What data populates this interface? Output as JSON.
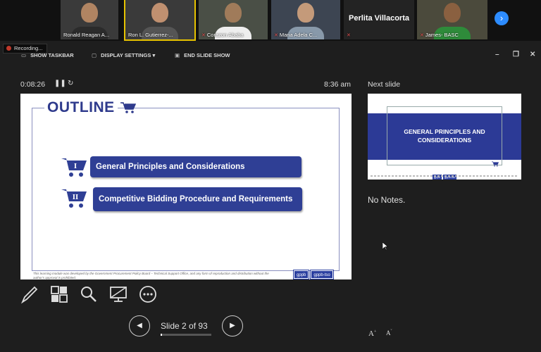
{
  "participants": [
    {
      "name": "Ronald Reagan A...",
      "muted": false
    },
    {
      "name": "Ron L. Gutierrez-...",
      "muted": false,
      "active": true
    },
    {
      "name": "Corazon Ababa",
      "muted": true
    },
    {
      "name": "Maria Adela C...",
      "muted": true
    },
    {
      "name": "Perlita Villacorta",
      "muted": true,
      "video": false
    },
    {
      "name": "James- BASC",
      "muted": true
    }
  ],
  "participants_next_icon": "chevron-right-icon",
  "recording": {
    "label": "Recording..."
  },
  "toolbar": {
    "show_taskbar": "SHOW TASKBAR",
    "display_settings": "DISPLAY SETTINGS ▾",
    "end_slide_show": "END SLIDE SHOW"
  },
  "presenter": {
    "timer": "0:08:26",
    "clock": "8:36 am",
    "next_slide_label": "Next slide",
    "notes": "No Notes."
  },
  "current_slide": {
    "title": "OUTLINE",
    "items": [
      {
        "numeral": "I",
        "text": "General Principles and Considerations"
      },
      {
        "numeral": "II",
        "text": "Competitive Bidding Procedure and Requirements"
      }
    ],
    "footer": "This learning module was developed by the Government Procurement Policy Board – Technical Support Office, and any form of reproduction and distribution without the author's approval is prohibited.",
    "logos": [
      "gppb",
      "gppb-tso"
    ]
  },
  "next_slide": {
    "title": "GENERAL PRINCIPLES AND CONSIDERATIONS",
    "logos": [
      "gppb",
      "gppb-tso"
    ]
  },
  "navigation": {
    "slide_label": "Slide 2 of 93",
    "current": 2,
    "total": 93,
    "progress_fraction": 0.0215
  },
  "tools": [
    "pen-icon",
    "see-all-slides-icon",
    "zoom-icon",
    "black-screen-icon",
    "more-options-icon"
  ],
  "colors": {
    "accent": "#2f3f95",
    "title": "#2e3a8c",
    "background": "#1e1e1e",
    "zoom_blue": "#2d8cff"
  }
}
